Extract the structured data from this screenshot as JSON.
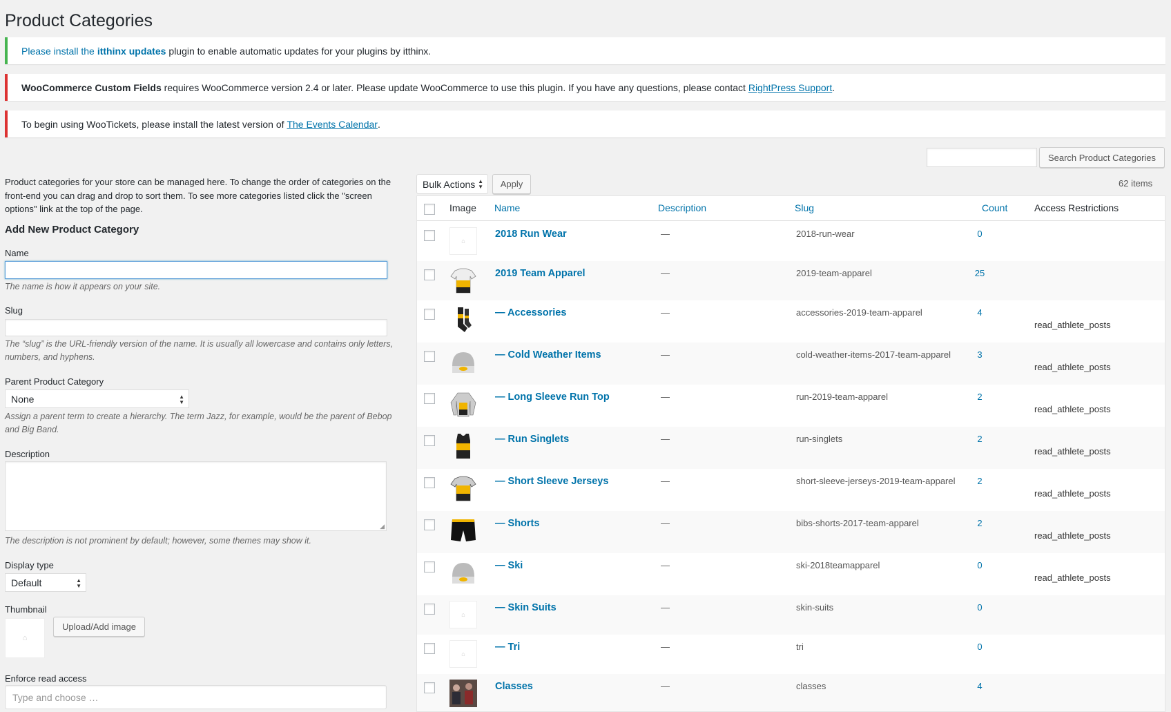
{
  "page_title": "Product Categories",
  "notices": {
    "n1": {
      "pre": "Please install the ",
      "link": "itthinx updates",
      "post": " plugin to enable automatic updates for your plugins by itthinx."
    },
    "n2": {
      "bold": "WooCommerce Custom Fields",
      "text": " requires WooCommerce version 2.4 or later. Please update WooCommerce to use this plugin. If you have any questions, please contact ",
      "link": "RightPress Support",
      "post": "."
    },
    "n3": {
      "text": "To begin using WooTickets, please install the latest version of ",
      "link": "The Events Calendar",
      "post": "."
    }
  },
  "intro": "Product categories for your store can be managed here. To change the order of categories on the front-end you can drag and drop to sort them. To see more categories listed click the \"screen options\" link at the top of the page.",
  "form": {
    "heading": "Add New Product Category",
    "name_label": "Name",
    "name_help": "The name is how it appears on your site.",
    "slug_label": "Slug",
    "slug_help": "The “slug” is the URL-friendly version of the name. It is usually all lowercase and contains only letters, numbers, and hyphens.",
    "parent_label": "Parent Product Category",
    "parent_value": "None",
    "parent_help": "Assign a parent term to create a hierarchy. The term Jazz, for example, would be the parent of Bebop and Big Band.",
    "desc_label": "Description",
    "desc_help": "The description is not prominent by default; however, some themes may show it.",
    "display_label": "Display type",
    "display_value": "Default",
    "thumb_label": "Thumbnail",
    "upload_button": "Upload/Add image",
    "enforce_label": "Enforce read access",
    "enforce_placeholder": "Type and choose …"
  },
  "search": {
    "button": "Search Product Categories",
    "value": ""
  },
  "bulk": {
    "select": "Bulk Actions",
    "apply": "Apply",
    "items": "62 items"
  },
  "columns": {
    "image": "Image",
    "name": "Name",
    "description": "Description",
    "slug": "Slug",
    "count": "Count",
    "access": "Access Restrictions"
  },
  "rows": [
    {
      "name": "2018 Run Wear",
      "desc": "—",
      "slug": "2018-run-wear",
      "count": "0",
      "access": "",
      "thumb": "empty"
    },
    {
      "name": "2019 Team Apparel",
      "desc": "—",
      "slug": "2019-team-apparel",
      "count": "25",
      "access": "",
      "thumb": "jersey"
    },
    {
      "name": "— Accessories",
      "desc": "—",
      "slug": "accessories-2019-team-apparel",
      "count": "4",
      "access": "read_athlete_posts",
      "thumb": "socks"
    },
    {
      "name": "— Cold Weather Items",
      "desc": "—",
      "slug": "cold-weather-items-2017-team-apparel",
      "count": "3",
      "access": "read_athlete_posts",
      "thumb": "beanie"
    },
    {
      "name": "— Long Sleeve Run Top",
      "desc": "—",
      "slug": "run-2019-team-apparel",
      "count": "2",
      "access": "read_athlete_posts",
      "thumb": "longsleeve"
    },
    {
      "name": "— Run Singlets",
      "desc": "—",
      "slug": "run-singlets",
      "count": "2",
      "access": "read_athlete_posts",
      "thumb": "singlet"
    },
    {
      "name": "— Short Sleeve Jerseys",
      "desc": "—",
      "slug": "short-sleeve-jerseys-2019-team-apparel",
      "count": "2",
      "access": "read_athlete_posts",
      "thumb": "jersey2"
    },
    {
      "name": "— Shorts",
      "desc": "—",
      "slug": "bibs-shorts-2017-team-apparel",
      "count": "2",
      "access": "read_athlete_posts",
      "thumb": "shorts"
    },
    {
      "name": "— Ski",
      "desc": "—",
      "slug": "ski-2018teamapparel",
      "count": "0",
      "access": "read_athlete_posts",
      "thumb": "beanie"
    },
    {
      "name": "— Skin Suits",
      "desc": "—",
      "slug": "skin-suits",
      "count": "0",
      "access": "",
      "thumb": "empty"
    },
    {
      "name": "— Tri",
      "desc": "—",
      "slug": "tri",
      "count": "0",
      "access": "",
      "thumb": "empty"
    },
    {
      "name": "Classes",
      "desc": "—",
      "slug": "classes",
      "count": "4",
      "access": "",
      "thumb": "photo"
    }
  ]
}
